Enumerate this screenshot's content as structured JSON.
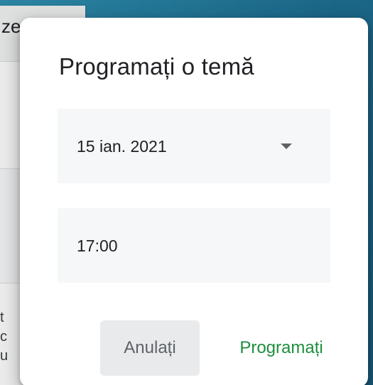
{
  "background_page": {
    "title_fragment": "ze",
    "text_lines": [
      "t",
      "c",
      "u"
    ]
  },
  "dialog": {
    "title": "Programați o temă",
    "date_field": {
      "value": "15 ian. 2021",
      "icon": "chevron-down-icon"
    },
    "time_field": {
      "value": "17:00"
    },
    "actions": {
      "cancel_label": "Anulați",
      "schedule_label": "Programați"
    }
  },
  "colors": {
    "accent": "#1e8e3e",
    "dialog_background": "#ffffff",
    "field_background": "#f5f7f8",
    "cancel_background": "#e8eaeb",
    "page_background": "#2f8fb0"
  }
}
